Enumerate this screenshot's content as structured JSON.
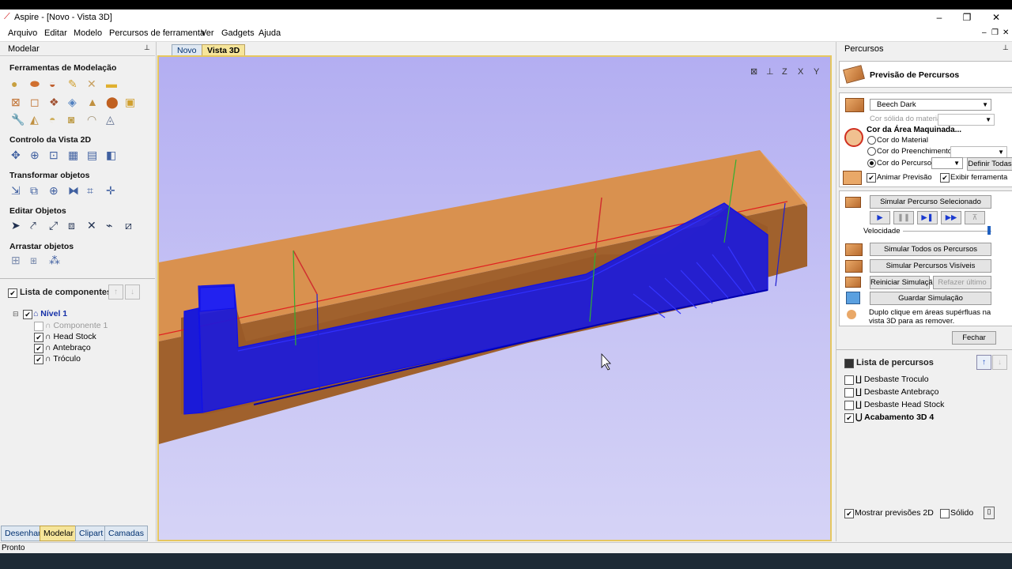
{
  "window": {
    "title": "Aspire - [Novo - Vista 3D]",
    "min": "–",
    "max": "❐",
    "close": "✕",
    "mdi_min": "–",
    "mdi_max": "❐",
    "mdi_close": "✕"
  },
  "menu": [
    "Arquivo",
    "Editar",
    "Modelo",
    "Percursos de ferramenta",
    "Ver",
    "Gadgets",
    "Ajuda"
  ],
  "left": {
    "title": "Modelar",
    "pin": "📌",
    "sections": [
      "Ferramentas de Modelação",
      "Controlo da Vista 2D",
      "Transformar objetos",
      "Editar Objetos",
      "Arrastar objetos"
    ],
    "components_title": "Lista de componentes",
    "tree": {
      "level": "Nível 1",
      "items": [
        "Componente 1",
        "Head Stock",
        "Antebraço",
        "Tróculo"
      ]
    },
    "tabs": [
      "Desenhar",
      "Modelar",
      "Clipart",
      "Camadas"
    ]
  },
  "view": {
    "tabs": [
      "Novo",
      "Vista 3D"
    ]
  },
  "right": {
    "title": "Percursos",
    "pin": "📌",
    "preview_title": "Previsão de Percursos",
    "material": "Beech Dark",
    "solid_color": "Cor sólida do material",
    "machined_color": "Cor da Área Maquinada...",
    "radio": [
      "Cor do Material",
      "Cor do Preenchimento",
      "Cor do Percurso"
    ],
    "set_all": "Definir Todas",
    "animate": "Animar Previsão",
    "show_tool": "Exibir ferramenta",
    "simulate_selected": "Simular Percurso Selecionado",
    "speed": "Velocidade",
    "speed_value": 0.97,
    "simulate_all": "Simular Todos os Percursos",
    "simulate_visible": "Simular Percursos Visíveis",
    "reset": "Reiniciar Simulação",
    "redo": "Refazer último",
    "save": "Guardar Simulação",
    "hint": "Duplo clique em áreas supérfluas na vista 3D para as remover.",
    "close": "Fechar",
    "list_title": "Lista de percursos",
    "toolpaths": [
      {
        "name": "Desbaste Troculo",
        "checked": false
      },
      {
        "name": "Desbaste Antebraço",
        "checked": false
      },
      {
        "name": "Desbaste Head Stock",
        "checked": false
      },
      {
        "name": "Acabamento 3D 4",
        "checked": true
      }
    ],
    "show_2d": "Mostrar previsões 2D",
    "solid": "Sólido"
  },
  "status": "Pronto",
  "colors": {
    "wood_top": "#d9914f",
    "wood_side": "#a0612d",
    "toolpath": "#1010e8",
    "tab_active": "#f6e59a"
  }
}
